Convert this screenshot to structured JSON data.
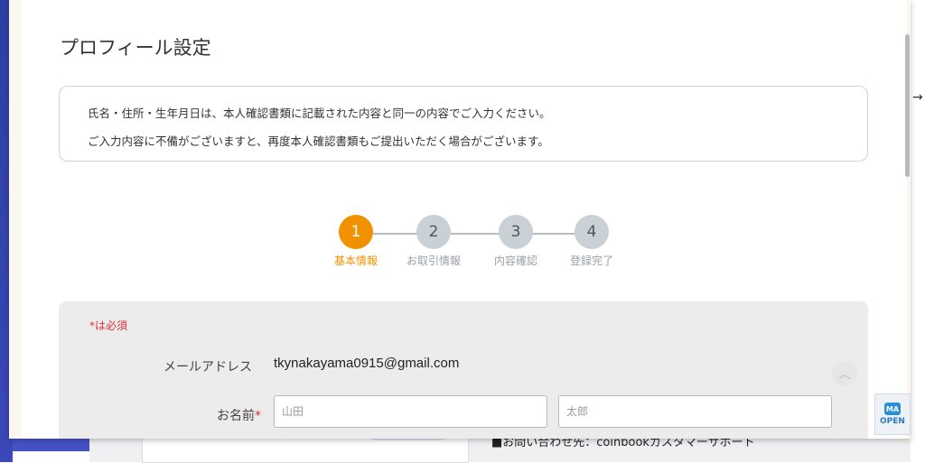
{
  "page": {
    "title": "プロフィール設定"
  },
  "info": {
    "line1": "氏名・住所・生年月日は、本人確認書類に記載された内容と同一の内容でご入力ください。",
    "line2": "ご入力内容に不備がございますと、再度本人確認書類もご提出いただく場合がございます。"
  },
  "stepper": {
    "steps": [
      {
        "number": "1",
        "label": "基本情報",
        "active": true
      },
      {
        "number": "2",
        "label": "お取引情報",
        "active": false
      },
      {
        "number": "3",
        "label": "内容確認",
        "active": false
      },
      {
        "number": "4",
        "label": "登録完了",
        "active": false
      }
    ]
  },
  "form": {
    "required_note": "*は必須",
    "email_label": "メールアドレス",
    "email_value": "tkynakayama0915@gmail.com",
    "name_label": "お名前",
    "required_mark": "*",
    "last_name_placeholder": "山田",
    "first_name_placeholder": "太郎"
  },
  "background": {
    "notice": "■お問い合わせ先：coinbookカスタマーサポート",
    "arrow": "→"
  },
  "badge": {
    "logo_text": "MA",
    "label": "OPEN"
  },
  "colors": {
    "accent": "#f29100",
    "required": "#e0303a",
    "inactive_step": "#c9d0d6"
  }
}
